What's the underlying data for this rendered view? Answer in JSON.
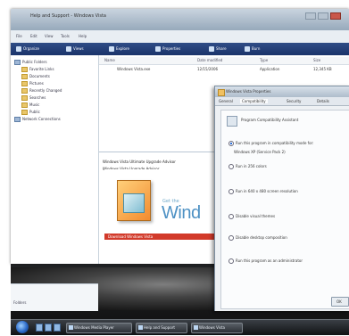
{
  "explorer": {
    "title": "Help and Support - Windows Vista",
    "menubar": [
      "File",
      "Edit",
      "View",
      "Tools",
      "Help"
    ],
    "toolbar": [
      "Organize",
      "Views",
      "Explore",
      "Properties",
      "Share",
      "Burn"
    ],
    "nav": {
      "items": [
        "Public Folders",
        "Favorite Links",
        "Documents",
        "Pictures",
        "Recently Changed",
        "Searches",
        "Music",
        "Public",
        "Network Connections"
      ],
      "bottom_label": "Folders"
    },
    "filelist": {
      "columns": [
        "Name",
        "Date modified",
        "Type",
        "Size"
      ],
      "row": {
        "name": "Windows Vista.exe",
        "date": "12/15/2006",
        "type": "Application",
        "size": "12,345 KB"
      }
    },
    "details": {
      "line1": "Windows Vista Ultimate Upgrade Advisor",
      "line2": "Windows Vista Upgrade Advisor"
    },
    "promo": {
      "small": "Get the",
      "big": "Wind",
      "bar": "Download Windows Vista"
    }
  },
  "dialog": {
    "title": "Windows Vista Properties",
    "tabs": [
      "General",
      "Compatibility",
      "Security",
      "Details"
    ],
    "intro": "Program Compatibility Assistant",
    "options": [
      "Run this program in compatibility mode for:",
      "Windows XP (Service Pack 2)",
      "Run in 256 colors",
      "Run in 640 x 480 screen resolution",
      "Disable visual themes",
      "Disable desktop composition",
      "Run this program as an administrator"
    ],
    "ok": "OK"
  },
  "taskbar": {
    "items": [
      "Windows Media Player",
      "Help and Support",
      "Windows Vista"
    ]
  }
}
